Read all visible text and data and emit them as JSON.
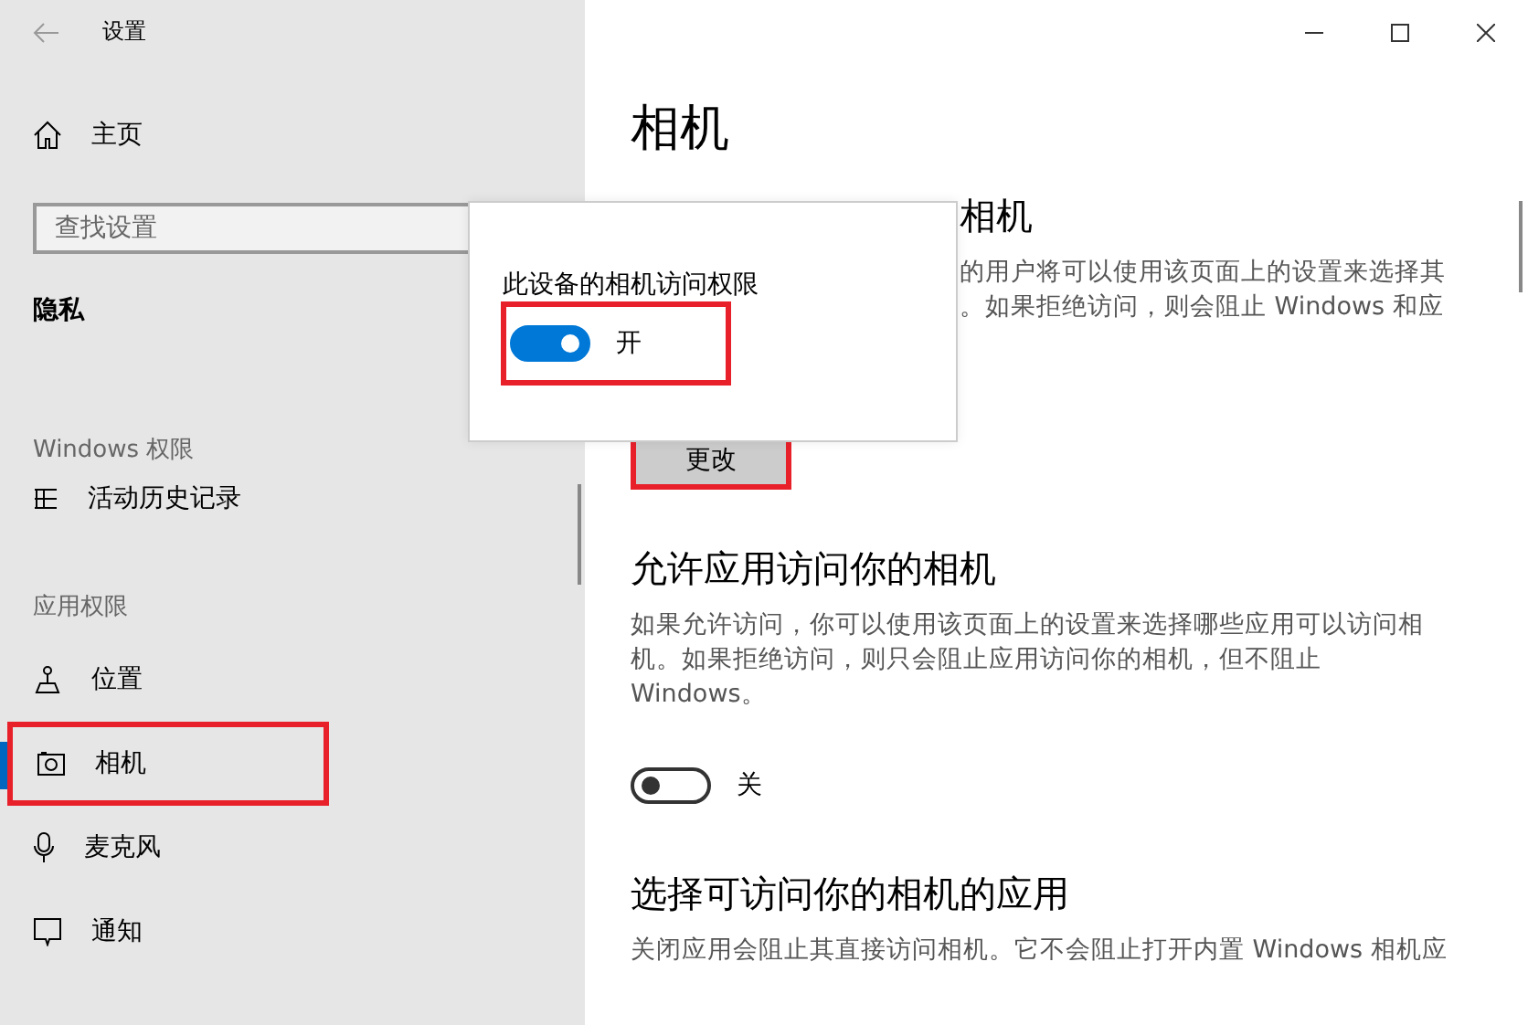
{
  "window": {
    "title": "设置"
  },
  "sidebar": {
    "home": "主页",
    "search": {
      "placeholder": "查找设置"
    },
    "section_title": "隐私",
    "groups": [
      {
        "title": "Windows 权限",
        "items": [
          {
            "label": "活动历史记录",
            "selected": false,
            "highlighted": false
          }
        ]
      },
      {
        "title": "应用权限",
        "items": [
          {
            "label": "位置",
            "selected": false,
            "highlighted": false
          },
          {
            "label": "相机",
            "selected": true,
            "highlighted": true
          },
          {
            "label": "麦克风",
            "selected": false,
            "highlighted": false
          },
          {
            "label": "通知",
            "selected": false,
            "highlighted": false
          }
        ]
      }
    ]
  },
  "main": {
    "title": "相机",
    "device_section": {
      "heading": "相机",
      "lines": [
        "的用户将可以使用该页面上的设置来选择其",
        "。如果拒绝访问，则会阻止 Windows 和应"
      ],
      "button": {
        "label": "更改",
        "highlighted": true
      }
    },
    "apps_section": {
      "heading": "允许应用访问你的相机",
      "description": "如果允许访问，你可以使用该页面上的设置来选择哪些应用可以访问相机。如果拒绝访问，则只会阻止应用访问你的相机，但不阻止 Windows。",
      "toggle": {
        "on": false,
        "label": "关"
      }
    },
    "choose_section": {
      "heading": "选择可访问你的相机的应用",
      "description": "关闭应用会阻止其直接访问相机。它不会阻止打开内置 Windows 相机应"
    }
  },
  "popup": {
    "label": "此设备的相机访问权限",
    "toggle": {
      "on": true,
      "label": "开",
      "highlighted": true
    }
  }
}
